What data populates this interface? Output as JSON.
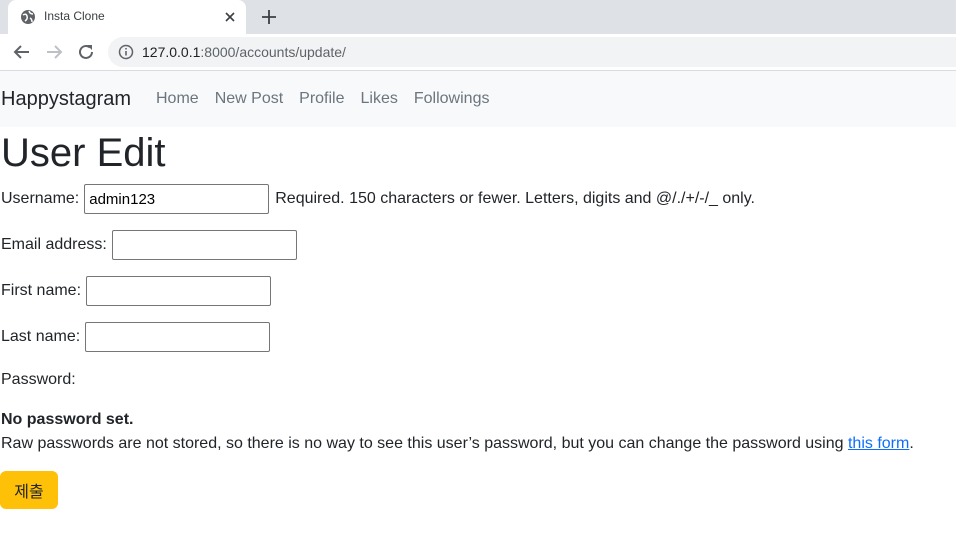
{
  "browser": {
    "tab_title": "Insta Clone",
    "url_host": "127.0.0.1",
    "url_rest": ":8000/accounts/update/"
  },
  "navbar": {
    "brand": "Happystagram",
    "links": [
      "Home",
      "New Post",
      "Profile",
      "Likes",
      "Followings"
    ]
  },
  "page": {
    "title": "User Edit",
    "username_label": "Username:",
    "username_value": "admin123",
    "username_help": "Required. 150 characters or fewer. Letters, digits and @/./+/-/_ only.",
    "email_label": "Email address:",
    "email_value": "",
    "first_name_label": "First name:",
    "first_name_value": "",
    "last_name_label": "Last name:",
    "last_name_value": "",
    "password_label": "Password:",
    "password_status": "No password set.",
    "password_help": "Raw passwords are not stored, so there is no way to see this user’s password, but you can change the password using ",
    "password_link": "this form",
    "password_help_end": ".",
    "submit_label": "제출"
  },
  "colors": {
    "submit_bg": "#ffc107",
    "link": "#0d6efd",
    "navbar_bg": "#f8f9fa"
  }
}
